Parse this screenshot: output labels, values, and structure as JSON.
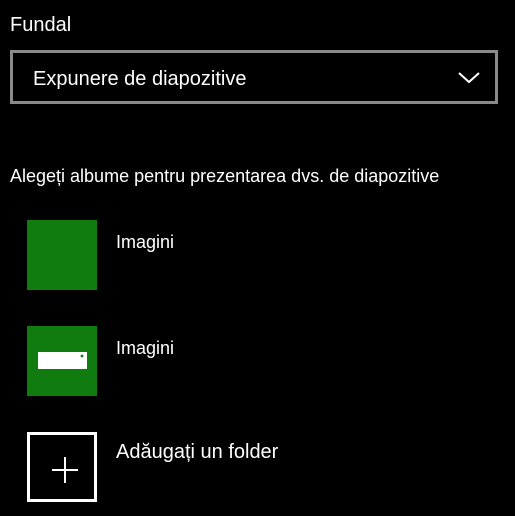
{
  "background": {
    "section_label": "Fundal",
    "dropdown": {
      "selected_value": "Expunere de diapozitive",
      "icon": "chevron-down-icon"
    }
  },
  "slideshow": {
    "prompt": "Alegeți albume pentru prezentarea dvs. de diapozitive",
    "albums": [
      {
        "label": "Imagini",
        "thumbnail_color": "#107c10"
      },
      {
        "label": "Imagini",
        "thumbnail_color": "#107c10",
        "icon": "device-icon"
      }
    ],
    "add_folder": {
      "label": "Adăugați un folder",
      "icon": "plus-icon"
    }
  },
  "colors": {
    "accent": "#107c10",
    "background": "#000000",
    "text": "#ffffff",
    "dropdown_border": "#8a8a8a"
  }
}
